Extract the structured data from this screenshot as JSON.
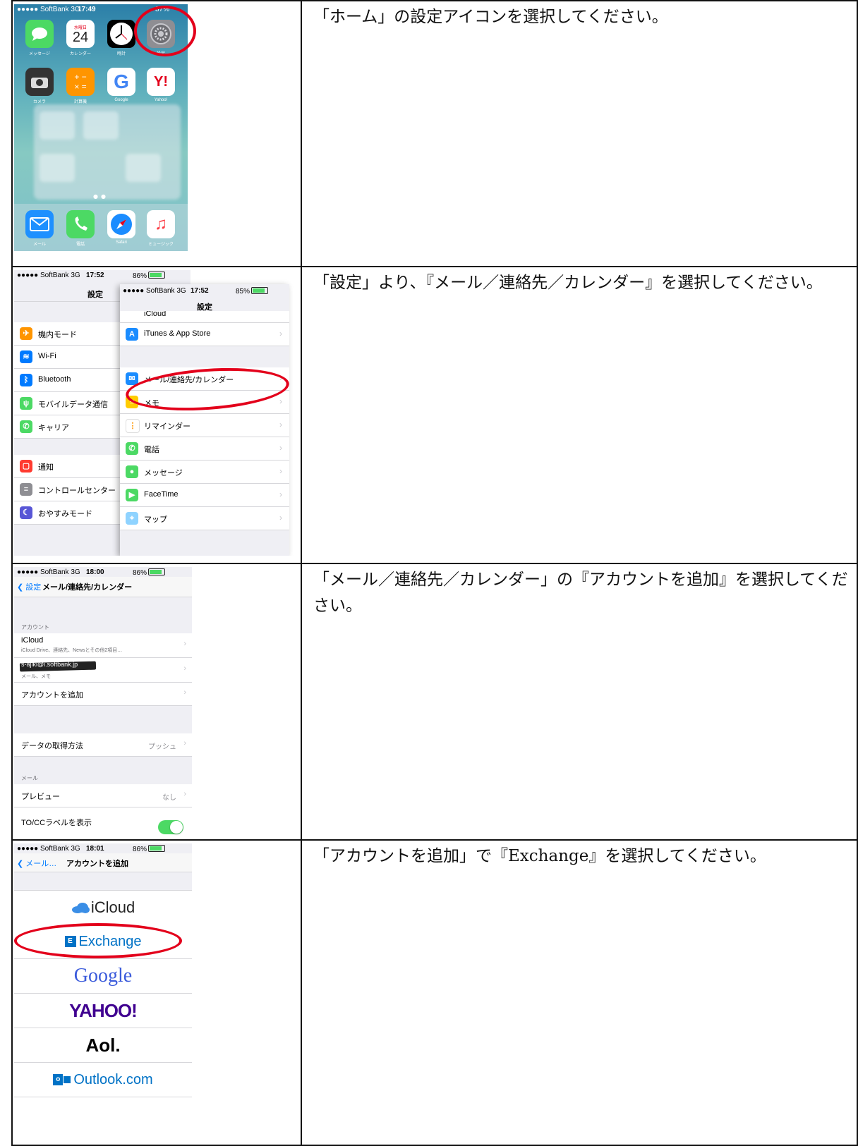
{
  "rows": [
    {
      "instruction": "「ホーム」の設定アイコンを選択してください。",
      "screenshot": {
        "status": {
          "carrier": "●●●●● SoftBank 3G",
          "time": "17:49",
          "battery": "87%"
        },
        "apps": [
          "メッセージ",
          "カレンダー",
          "時計",
          "設定",
          "カメラ",
          "計算機",
          "Google",
          "Yahoo!"
        ],
        "dock": [
          "メール",
          "電話",
          "Safari",
          "ミュージック"
        ],
        "calendar_weekday": "水曜日",
        "calendar_day": "24"
      }
    },
    {
      "instruction": "「設定」より、『メール／連絡先／カレンダー』を選択してください。",
      "screenshot_a": {
        "status": {
          "carrier": "●●●●● SoftBank 3G",
          "time": "17:52",
          "battery": "86%"
        },
        "title": "設定",
        "items": [
          "機内モード",
          "Wi-Fi",
          "Bluetooth",
          "モバイルデータ通信",
          "キャリア",
          "通知",
          "コントロールセンター",
          "おやすみモード"
        ]
      },
      "screenshot_b": {
        "status": {
          "carrier": "●●●●● SoftBank 3G",
          "time": "17:52",
          "battery": "85%"
        },
        "title": "設定",
        "items": [
          "iCloud",
          "iTunes & App Store",
          "メール/連絡先/カレンダー",
          "メモ",
          "リマインダー",
          "電話",
          "メッセージ",
          "FaceTime",
          "マップ"
        ]
      }
    },
    {
      "instruction": "「メール／連絡先／カレンダー」の『アカウントを追加』を選択してください。",
      "screenshot": {
        "status": {
          "carrier": "●●●●● SoftBank 3G",
          "time": "18:00",
          "battery": "86%"
        },
        "back": "設定",
        "title": "メール/連絡先/カレンダー",
        "accounts_header": "アカウント",
        "icloud": "iCloud",
        "icloud_sub": "iCloud Drive、連絡先、Newsとその他2項目…",
        "account_email": "s-ajiki@i.softbank.jp",
        "account_sub": "メール、メモ",
        "add_account": "アカウントを追加",
        "fetch_label": "データの取得方法",
        "fetch_value": "プッシュ",
        "mail_header": "メール",
        "preview_label": "プレビュー",
        "preview_value": "なし",
        "tocc_label": "TO/CCラベルを表示"
      }
    },
    {
      "instruction": "「アカウントを追加」で『Exchange』を選択してください。",
      "screenshot": {
        "status": {
          "carrier": "●●●●● SoftBank 3G",
          "time": "18:01",
          "battery": "86%"
        },
        "back": "メール…",
        "title": "アカウントを追加",
        "providers": [
          "iCloud",
          "Exchange",
          "Google",
          "YAHOO!",
          "Aol.",
          "Outlook.com"
        ]
      }
    }
  ]
}
